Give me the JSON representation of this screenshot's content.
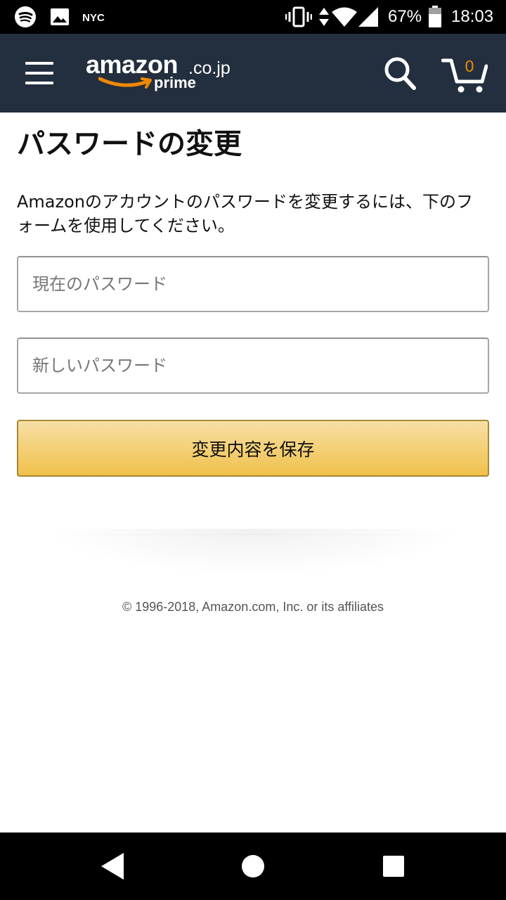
{
  "status_bar": {
    "icons": [
      "spotify-icon",
      "gallery-icon",
      "nyc-icon",
      "vibrate-icon",
      "data-arrows-icon",
      "wifi-icon",
      "signal-icon",
      "battery-icon"
    ],
    "nyc_label": "NYC",
    "battery": "67%",
    "time": "18:03"
  },
  "header": {
    "logo": {
      "word": "amazon",
      "tld": ".co.jp",
      "prime": "prime"
    },
    "cart_count": "0",
    "colors": {
      "background": "#232f3e",
      "accent": "#f08804"
    }
  },
  "main": {
    "title": "パスワードの変更",
    "description": "Amazonのアカウントのパスワードを変更するには、下のフォームを使用してください。",
    "current_password": {
      "placeholder": "現在のパスワード",
      "value": ""
    },
    "new_password": {
      "placeholder": "新しいパスワード",
      "value": ""
    },
    "save_label": "変更内容を保存",
    "colors": {
      "button_top": "#f7dfa5",
      "button_bottom": "#f0c14b",
      "button_border": "#a88734"
    }
  },
  "footer": {
    "copyright": "© 1996-2018, Amazon.com, Inc. or its affiliates"
  },
  "nav_bar": {
    "icons": [
      "back-icon",
      "home-icon",
      "recents-icon"
    ]
  }
}
